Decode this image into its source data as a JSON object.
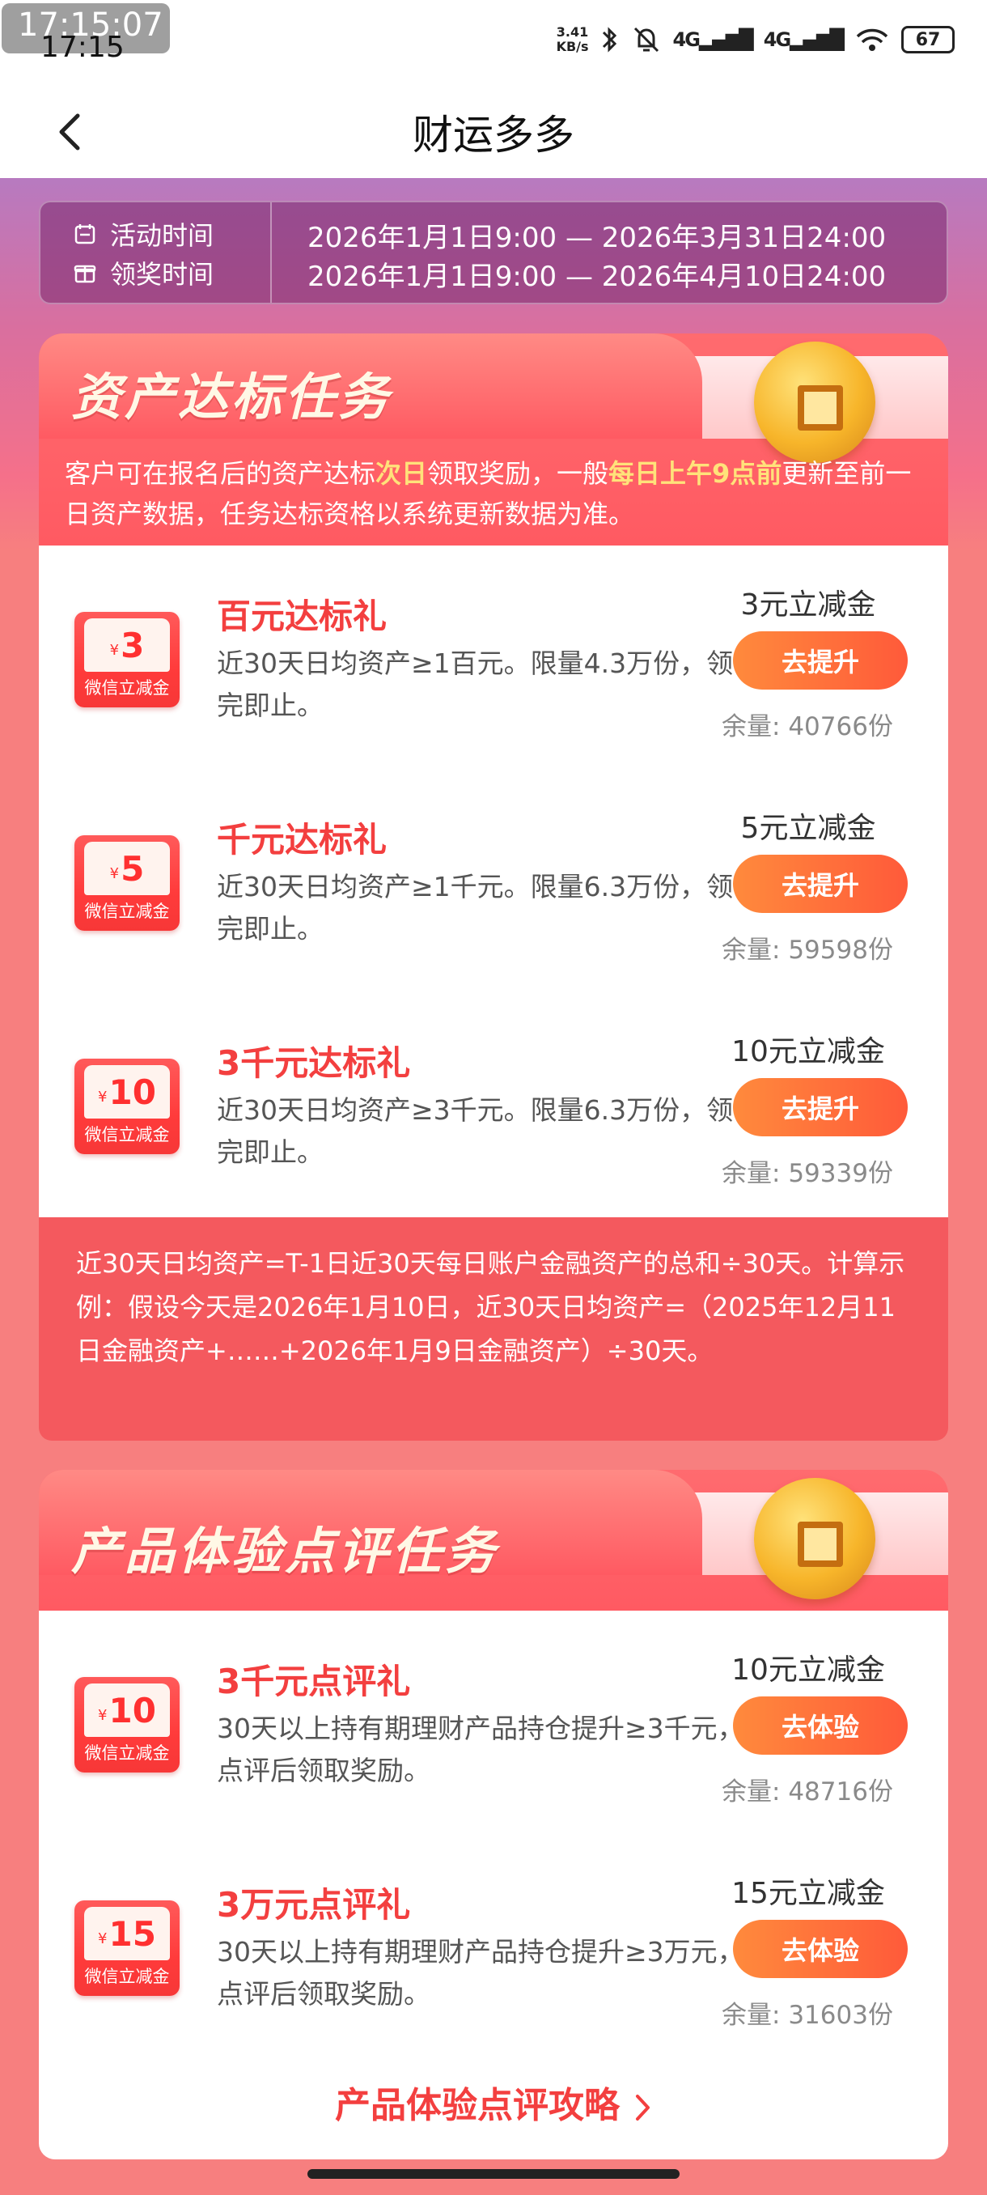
{
  "status_bar": {
    "overlay_time": "17:15:07",
    "time": "17:15",
    "net_speed_value": "3.41",
    "net_speed_unit": "KB/s",
    "signal_1": "4G",
    "signal_2": "4G",
    "wifi_sub": "6",
    "battery": "67"
  },
  "nav": {
    "title": "财运多多"
  },
  "activity": {
    "activity_time_label": "活动时间",
    "activity_time_value": "2026年1月1日9:00 — 2026年3月31日24:00",
    "claim_time_label": "领奖时间",
    "claim_time_value": "2026年1月1日9:00 — 2026年4月10日24:00"
  },
  "asset_section": {
    "title": "资产达标任务",
    "desc_part1": "客户可在报名后的资产达标",
    "desc_hl1": "次日",
    "desc_part2": "领取奖励，一般",
    "desc_hl2": "每日上午9点前",
    "desc_part3": "更新至前一日资产数据，任务达标资格以系统更新数据为准。",
    "tasks": [
      {
        "coupon_amount": "3",
        "coupon_label": "微信立减金",
        "title": "百元达标礼",
        "desc": "近30天日均资产≥1百元。限量4.3万份，领完即止。",
        "reward": "3元立减金",
        "button": "去提升",
        "remain": "余量: 40766份"
      },
      {
        "coupon_amount": "5",
        "coupon_label": "微信立减金",
        "title": "千元达标礼",
        "desc": "近30天日均资产≥1千元。限量6.3万份，领完即止。",
        "reward": "5元立减金",
        "button": "去提升",
        "remain": "余量: 59598份"
      },
      {
        "coupon_amount": "10",
        "coupon_label": "微信立减金",
        "title": "3千元达标礼",
        "desc": "近30天日均资产≥3千元。限量6.3万份，领完即止。",
        "reward": "10元立减金",
        "button": "去提升",
        "remain": "余量: 59339份"
      }
    ],
    "formula": "近30天日均资产=T-1日近30天每日账户金融资产的总和÷30天。计算示例：假设今天是2026年1月10日，近30天日均资产=（2025年12月11日金融资产+……+2026年1月9日金融资产）÷30天。"
  },
  "review_section": {
    "title": "产品体验点评任务",
    "tasks": [
      {
        "coupon_amount": "10",
        "coupon_label": "微信立减金",
        "title": "3千元点评礼",
        "desc": "30天以上持有期理财产品持仓提升≥3千元，点评后领取奖励。",
        "reward": "10元立减金",
        "button": "去体验",
        "remain": "余量: 48716份"
      },
      {
        "coupon_amount": "15",
        "coupon_label": "微信立减金",
        "title": "3万元点评礼",
        "desc": "30天以上持有期理财产品持仓提升≥3万元，点评后领取奖励。",
        "reward": "15元立减金",
        "button": "去体验",
        "remain": "余量: 31603份"
      }
    ],
    "guide_link": "产品体验点评攻略"
  },
  "colors": {
    "accent_red": "#f33f3f",
    "button_gradient_start": "#ff8a3c",
    "button_gradient_end": "#ff5a3a",
    "highlight_yellow": "#ffe27a",
    "page_bg": "#f77f7f"
  },
  "icons": [
    "back-icon",
    "bluetooth-icon",
    "mute-icon",
    "wifi-icon",
    "battery-icon",
    "calendar-icon",
    "gift-icon",
    "coin-icon",
    "chevron-right-icon"
  ]
}
